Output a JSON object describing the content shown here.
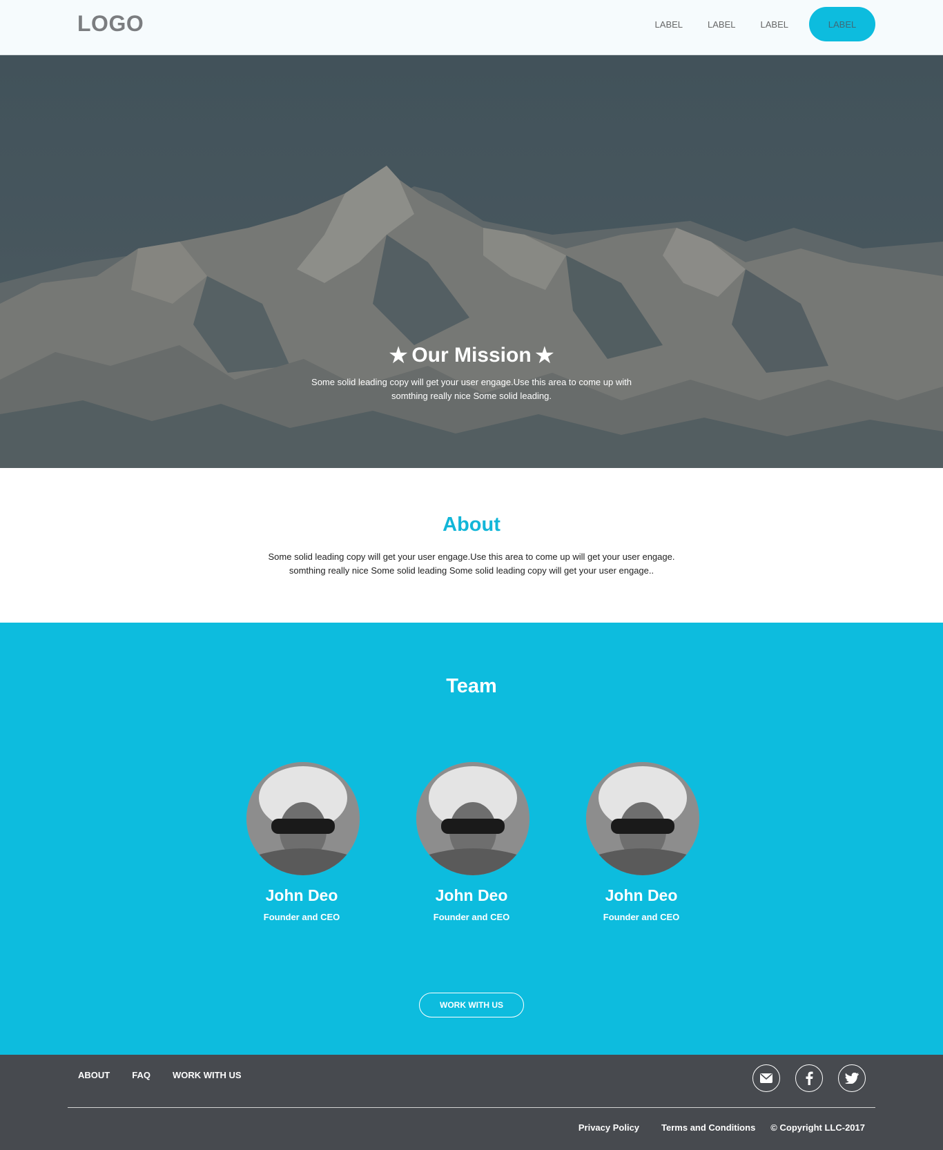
{
  "header": {
    "logo": "LOGO",
    "nav": [
      "LABEL",
      "LABEL",
      "LABEL"
    ],
    "cta": "LABEL"
  },
  "hero": {
    "title": "Our Mission",
    "text": "Some solid leading copy will get your user engage.Use this area to come up with somthing really nice Some solid leading."
  },
  "about": {
    "title": "About",
    "text": "Some solid leading copy will get your user engage.Use this area to come up will get your user engage. somthing really nice Some solid leading Some solid leading copy will get your user engage.."
  },
  "team": {
    "title": "Team",
    "members": [
      {
        "name": "John Deo",
        "role": "Founder and CEO"
      },
      {
        "name": "John Deo",
        "role": "Founder and CEO"
      },
      {
        "name": "John Deo",
        "role": "Founder and CEO"
      }
    ],
    "button": "WORK WITH US"
  },
  "footer": {
    "links": [
      "ABOUT",
      "FAQ",
      "WORK WITH US"
    ],
    "socials": [
      "mail-icon",
      "facebook-icon",
      "twitter-icon"
    ],
    "privacy": "Privacy Policy",
    "terms": "Terms and Conditions",
    "copyright": "© Copyright LLC-2017"
  },
  "colors": {
    "accent": "#0dbcde",
    "footer_bg": "#474a4f",
    "header_bg": "#f6fbfd"
  }
}
